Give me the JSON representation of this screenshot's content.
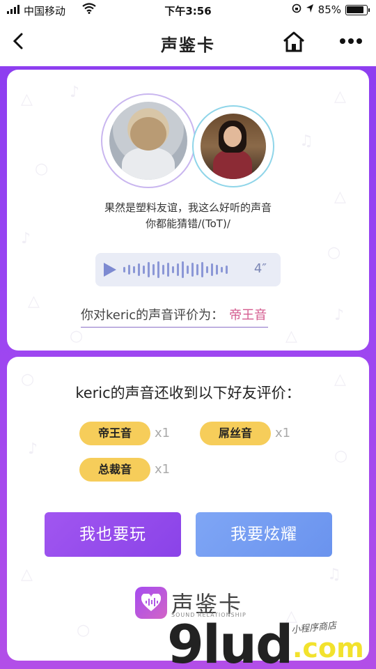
{
  "status": {
    "carrier": "中国移动",
    "time": "下午3:56",
    "battery": "85%"
  },
  "nav": {
    "title": "声鉴卡"
  },
  "card1": {
    "message_line1": "果然是塑料友谊，我这么好听的声音",
    "message_line2": "你都能猜错/(ToT)/",
    "voice_duration": "4″",
    "rating_label": "你对keric的声音评价为：",
    "rating_value": "帝王音"
  },
  "card2": {
    "title": "keric的声音还收到以下好友评价：",
    "tags": [
      {
        "label": "帝王音",
        "count": "x1"
      },
      {
        "label": "屌丝音",
        "count": "x1"
      },
      {
        "label": "总裁音",
        "count": "x1"
      }
    ],
    "buttons": {
      "play": "我也要玩",
      "show": "我要炫耀"
    },
    "logo": {
      "name": "声鉴卡",
      "subtitle": "SOUND RELATIONSHIP"
    }
  },
  "watermark": {
    "main": "9lud",
    "domain": ".com",
    "tagline": "小程序商店"
  },
  "colors": {
    "background": "#9a45f2",
    "accent_pink": "#d45c8f",
    "tag_yellow": "#f6cd5a",
    "button_purple": "#9a4ef0",
    "button_blue": "#7199ef"
  }
}
